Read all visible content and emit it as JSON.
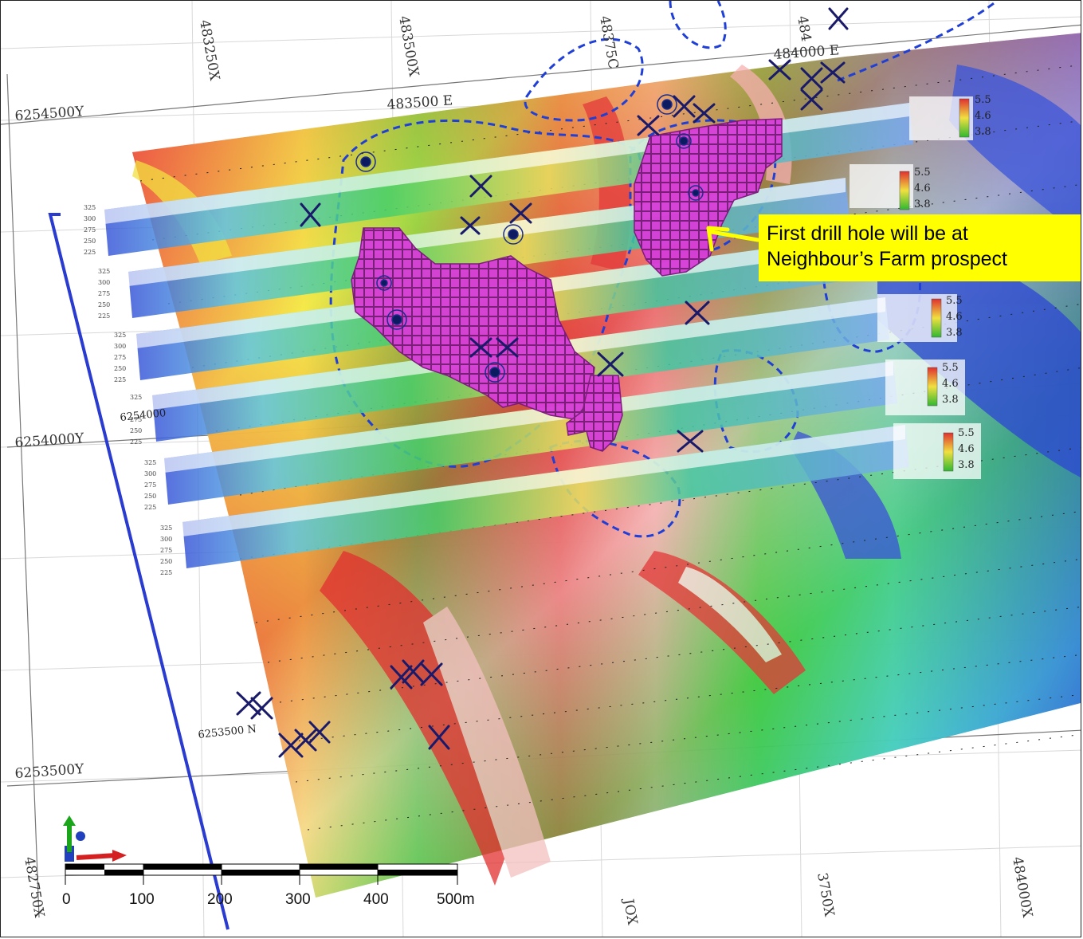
{
  "grid_labels": {
    "top_x": [
      "483250X",
      "483500X",
      "48375C",
      "484"
    ],
    "top_e": [
      "483500 E",
      "484000 E"
    ],
    "left_y": [
      "6254500Y",
      "6254000Y",
      "6253500Y"
    ],
    "bottom_x": [
      "482750X",
      "JOX",
      "3750X",
      "484000X"
    ],
    "inner_n": "6253500 N",
    "inner_section": "6254000"
  },
  "callout": {
    "line1": "First drill hole will be at",
    "line2": "Neighbour’s Farm prospect"
  },
  "section_scale_ticks": [
    "325",
    "300",
    "275",
    "250",
    "225"
  ],
  "colorbar_ticks": [
    "5.5",
    "4.6",
    "3.8"
  ],
  "scale_bar": {
    "labels": [
      "0",
      "100",
      "200",
      "300",
      "400",
      "500m"
    ]
  },
  "colors": {
    "callout_bg": "#ffff00",
    "anomaly_block": "#d63fd6",
    "prospect_outline": "#1f3fd6",
    "axis_x": "#d42020",
    "axis_y": "#1aa51a",
    "axis_z": "#2040c0"
  },
  "icons": [
    "north-axis-icon",
    "crossed-hammers-icon",
    "drill-hole-icon",
    "arrow-icon"
  ]
}
